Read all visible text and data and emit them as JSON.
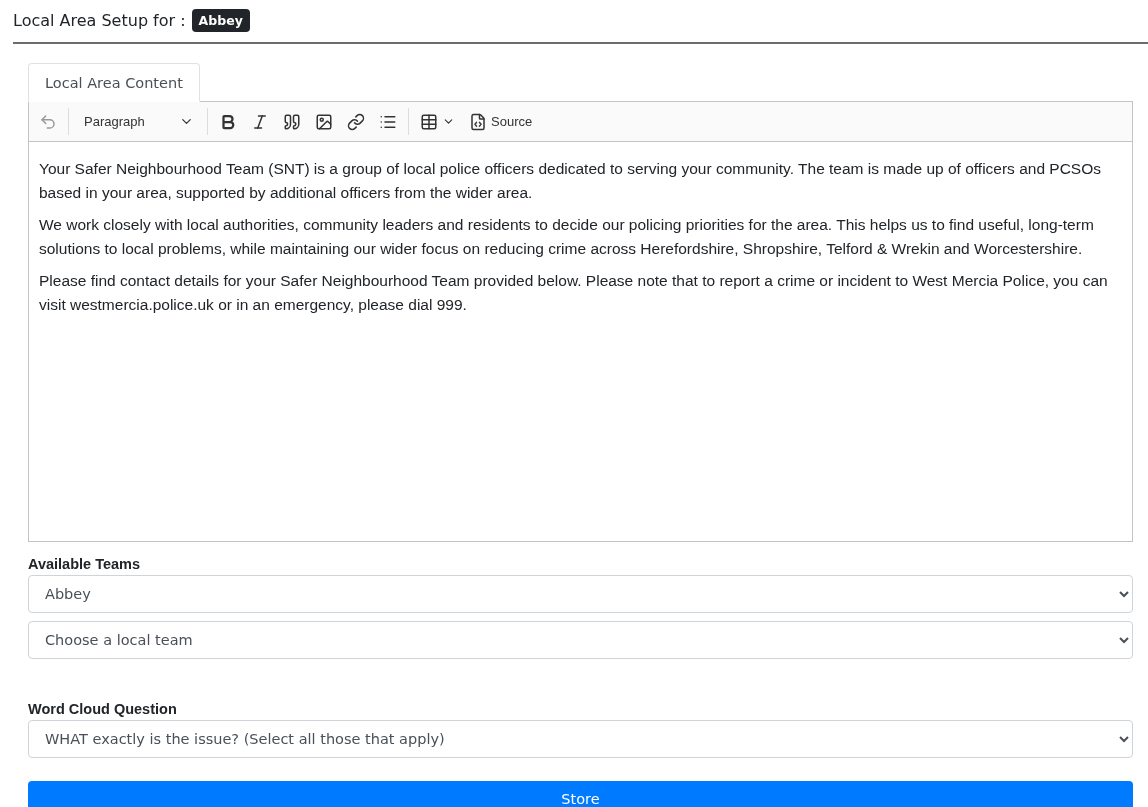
{
  "header": {
    "title": "Local Area Setup for :",
    "badge": "Abbey"
  },
  "tabs": [
    {
      "label": "Local Area Content",
      "selected": true
    }
  ],
  "toolbar": [
    {
      "kind": "undo",
      "disabled": true
    },
    {
      "kind": "dropdown",
      "label": "Paragraph"
    },
    {
      "kind": "bold"
    },
    {
      "kind": "italic"
    },
    {
      "kind": "quote"
    },
    {
      "kind": "image"
    },
    {
      "kind": "link"
    },
    {
      "kind": "list"
    },
    {
      "kind": "table"
    },
    {
      "kind": "source",
      "label": "Source"
    }
  ],
  "editor": {
    "paragraphs": [
      "Your Safer Neighbourhood Team (SNT) is a group of local police officers dedicated to serving your community. The team is made up of officers and PCSOs based in your area, supported by additional officers from the wider area.",
      "We work closely with local authorities, community leaders and residents to decide our policing priorities for the area. This helps us to find useful, long-term solutions to local problems, while maintaining our wider focus on reducing crime across Herefordshire, Shropshire, Telford & Wrekin and Worcestershire.",
      "Please find contact details for your Safer Neighbourhood Team provided below. Please note that to report a crime or incident to West Mercia Police, you can visit westmercia.police.uk or in an emergency, please dial 999."
    ]
  },
  "fields": [
    {
      "label": "Available Teams",
      "selects": [
        "Abbey",
        "Choose a local team"
      ]
    },
    {
      "label": "Word Cloud Question",
      "selects": [
        "WHAT exactly is the issue? (Select all those that apply)"
      ]
    }
  ],
  "submit": "Store"
}
